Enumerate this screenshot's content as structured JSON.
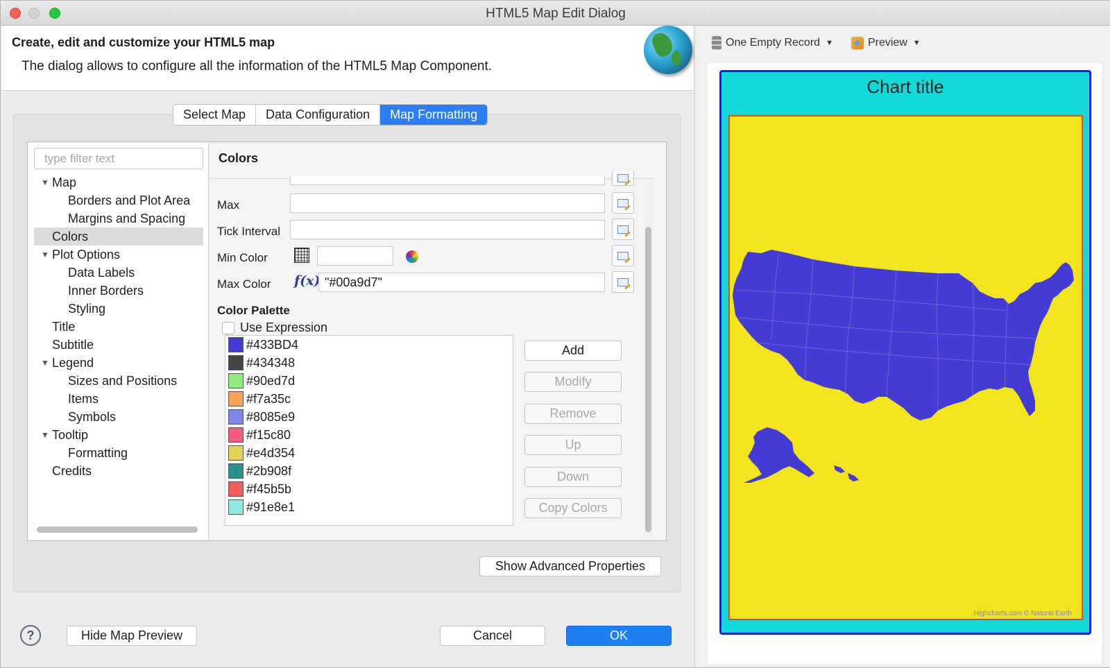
{
  "window": {
    "title": "HTML5 Map Edit Dialog"
  },
  "banner": {
    "title": "Create, edit and customize your HTML5 map",
    "description": "The dialog allows to configure all the information of the HTML5 Map Component."
  },
  "tabs": [
    "Select Map",
    "Data Configuration",
    "Map Formatting"
  ],
  "active_tab": "Map Formatting",
  "filter": {
    "placeholder": "type filter text",
    "value": ""
  },
  "tree": [
    {
      "label": "Map",
      "level": 0,
      "expanded": true
    },
    {
      "label": "Borders and Plot Area",
      "level": 1
    },
    {
      "label": "Margins and Spacing",
      "level": 1
    },
    {
      "label": "Colors",
      "level": 0,
      "selected": true
    },
    {
      "label": "Plot Options",
      "level": 0,
      "expanded": true
    },
    {
      "label": "Data Labels",
      "level": 1
    },
    {
      "label": "Inner Borders",
      "level": 1
    },
    {
      "label": "Styling",
      "level": 1
    },
    {
      "label": "Title",
      "level": 0
    },
    {
      "label": "Subtitle",
      "level": 0
    },
    {
      "label": "Legend",
      "level": 0,
      "expanded": true
    },
    {
      "label": "Sizes and Positions",
      "level": 1
    },
    {
      "label": "Items",
      "level": 1
    },
    {
      "label": "Symbols",
      "level": 1
    },
    {
      "label": "Tooltip",
      "level": 0,
      "expanded": true
    },
    {
      "label": "Formatting",
      "level": 1
    },
    {
      "label": "Credits",
      "level": 0
    }
  ],
  "content": {
    "title": "Colors",
    "max_label": "Max",
    "max_value": "",
    "tick_interval_label": "Tick Interval",
    "tick_interval_value": "",
    "min_color_label": "Min Color",
    "min_color_value": "",
    "max_color_label": "Max Color",
    "max_color_value": "\"#00a9d7\"",
    "palette_title": "Color Palette",
    "use_expression_label": "Use Expression",
    "use_expression_checked": false
  },
  "palette": [
    "#433BD4",
    "#434348",
    "#90ed7d",
    "#f7a35c",
    "#8085e9",
    "#f15c80",
    "#e4d354",
    "#2b908f",
    "#f45b5b",
    "#91e8e1"
  ],
  "palette_buttons": [
    {
      "label": "Add",
      "enabled": true
    },
    {
      "label": "Modify",
      "enabled": false
    },
    {
      "label": "Remove",
      "enabled": false
    },
    {
      "label": "Up",
      "enabled": false
    },
    {
      "label": "Down",
      "enabled": false
    },
    {
      "label": "Copy Colors",
      "enabled": false
    }
  ],
  "buttons": {
    "advanced": "Show Advanced Properties",
    "help": "?",
    "hide_preview": "Hide Map Preview",
    "cancel": "Cancel",
    "ok": "OK"
  },
  "preview": {
    "record_label": "One Empty Record",
    "preview_label": "Preview",
    "chart_title": "Chart title",
    "credits": "Highcharts.com © Natural Earth",
    "colors": {
      "chart_bg": "#14d9d9",
      "chart_border": "#1020e8",
      "plot_bg": "#f2e51e",
      "plot_border": "#c8552b",
      "map_fill": "#433BD4"
    }
  },
  "icons": {
    "grid": "color-grid-icon",
    "wheel": "color-wheel-icon",
    "fx": "expression-icon",
    "edit": "edit-icon",
    "globe": "globe-icon"
  }
}
